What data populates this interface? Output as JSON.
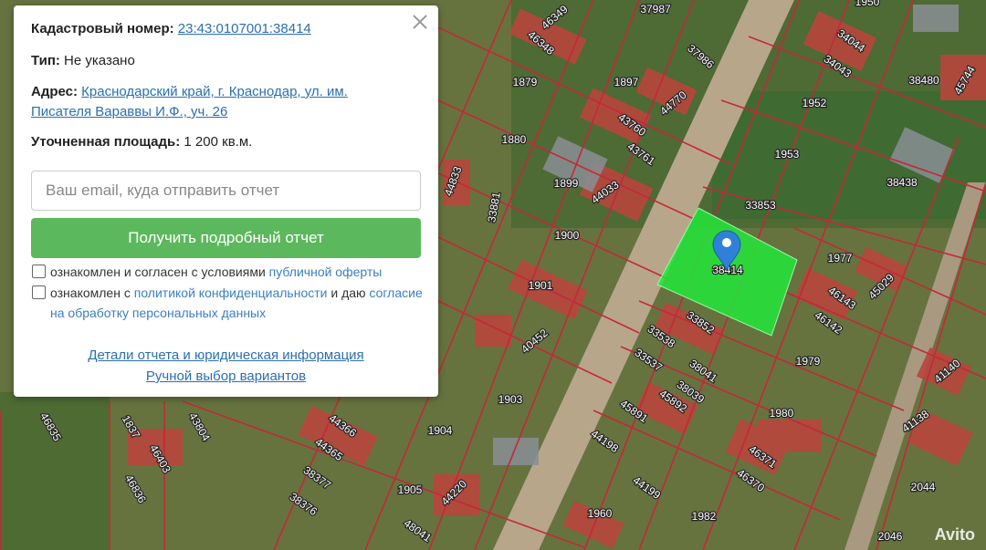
{
  "map": {
    "plot_labels": [
      "46349",
      "46348",
      "37987",
      "37986",
      "1950",
      "34044",
      "34043",
      "38480",
      "45744",
      "1879",
      "1897",
      "44770",
      "1952",
      "1880",
      "43760",
      "43761",
      "1953",
      "38438",
      "44833",
      "33881",
      "1899",
      "44033",
      "33853",
      "1900",
      "1977",
      "45029",
      "1901",
      "46143",
      "46142",
      "40452",
      "33852",
      "33538",
      "33537",
      "38041",
      "38039",
      "1979",
      "1903",
      "45891",
      "45892",
      "1980",
      "41140",
      "41138",
      "46835",
      "1837",
      "43804",
      "44366",
      "44365",
      "1904",
      "46371",
      "46370",
      "44198",
      "46403",
      "44199",
      "46836",
      "38377",
      "38376",
      "1905",
      "44220",
      "1960",
      "1982",
      "48041",
      "2044",
      "2046",
      "38414"
    ],
    "marker_plot": "38414",
    "colors": {
      "selected_plot": "#22e83a",
      "boundary": "#c5283a",
      "marker": "#2f80d8"
    }
  },
  "panel": {
    "cadastral_label": "Кадастровый номер:",
    "cadastral_value": "23:43:0107001:38414",
    "type_label": "Тип:",
    "type_value": "Не указано",
    "address_label": "Адрес:",
    "address_line1": "Краснодарский край, г. Краснодар, ул. им.",
    "address_line2": "Писателя Вараввы И.Ф., уч. 26",
    "area_label": "Уточненная площадь:",
    "area_value": "1 200 кв.м.",
    "email_placeholder": "Ваш email, куда отправить отчет",
    "submit_label": "Получить подробный отчет",
    "check1_text": "ознакомлен и согласен с условиями",
    "check1_link": "публичной оферты",
    "check2_text_a": "ознакомлен с",
    "check2_link_a": "политикой конфиденциальности",
    "check2_text_b": "и даю",
    "check2_link_b": "согласие на обработку персональных данных",
    "link_details": "Детали отчета и юридическая информация",
    "link_manual": "Ручной выбор вариантов"
  },
  "watermark": "Avito"
}
